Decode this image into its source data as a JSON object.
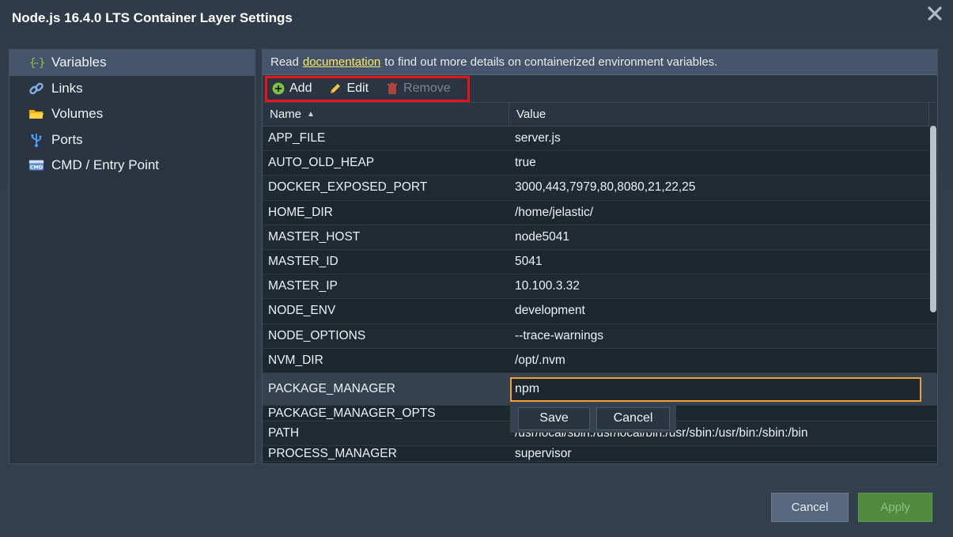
{
  "dialog": {
    "title": "Node.js 16.4.0 LTS Container Layer Settings"
  },
  "sidebar": {
    "items": [
      {
        "label": "Variables",
        "icon": "braces-icon"
      },
      {
        "label": "Links",
        "icon": "link-icon"
      },
      {
        "label": "Volumes",
        "icon": "folder-icon"
      },
      {
        "label": "Ports",
        "icon": "usb-icon"
      },
      {
        "label": "CMD / Entry Point",
        "icon": "cmd-icon"
      }
    ]
  },
  "info": {
    "prefix": "Read",
    "link": "documentation",
    "suffix": "to find out more details on containerized environment variables."
  },
  "toolbar": {
    "add": "Add",
    "edit": "Edit",
    "remove": "Remove"
  },
  "table": {
    "headers": {
      "name": "Name",
      "value": "Value"
    },
    "rows": [
      {
        "name": "APP_FILE",
        "value": "server.js"
      },
      {
        "name": "AUTO_OLD_HEAP",
        "value": "true"
      },
      {
        "name": "DOCKER_EXPOSED_PORT",
        "value": "3000,443,7979,80,8080,21,22,25"
      },
      {
        "name": "HOME_DIR",
        "value": "/home/jelastic/"
      },
      {
        "name": "MASTER_HOST",
        "value": "node5041"
      },
      {
        "name": "MASTER_ID",
        "value": "5041"
      },
      {
        "name": "MASTER_IP",
        "value": "10.100.3.32"
      },
      {
        "name": "NODE_ENV",
        "value": "development"
      },
      {
        "name": "NODE_OPTIONS",
        "value": "--trace-warnings"
      },
      {
        "name": "NVM_DIR",
        "value": "/opt/.nvm"
      }
    ],
    "editing_row": {
      "name": "PACKAGE_MANAGER",
      "value": "npm"
    },
    "rows_after": [
      {
        "name": "PACKAGE_MANAGER_OPTS",
        "value": ""
      },
      {
        "name": "PATH",
        "value": "/usr/local/sbin:/usr/local/bin:/usr/sbin:/usr/bin:/sbin:/bin"
      },
      {
        "name": "PROCESS_MANAGER",
        "value": "supervisor"
      }
    ],
    "edit_actions": {
      "save": "Save",
      "cancel": "Cancel"
    }
  },
  "footer": {
    "cancel": "Cancel",
    "apply": "Apply"
  },
  "colors": {
    "highlight": "#e8141a",
    "edit_border": "#f0a030",
    "apply": "#4f8a3f",
    "link": "#ffeb66"
  }
}
